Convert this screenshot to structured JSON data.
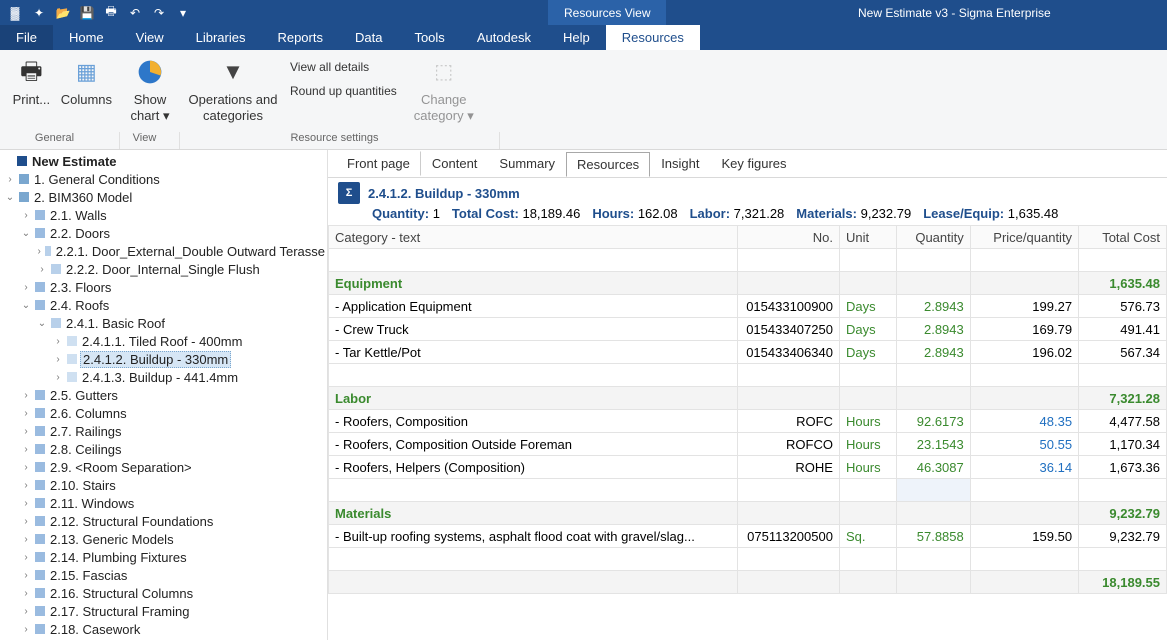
{
  "window": {
    "context_tab": "Resources View",
    "document": "New Estimate v3 - Sigma Enterprise"
  },
  "menus": {
    "file": "File",
    "home": "Home",
    "view": "View",
    "libraries": "Libraries",
    "reports": "Reports",
    "data": "Data",
    "tools": "Tools",
    "autodesk": "Autodesk",
    "help": "Help",
    "resources": "Resources"
  },
  "ribbon": {
    "print": "Print...",
    "columns": "Columns",
    "showchart": "Show chart",
    "ops": "Operations and categories",
    "viewall": "View all details",
    "roundup": "Round up quantities",
    "changecat": "Change category",
    "g1": "General",
    "g2": "View",
    "g3": "Resource settings"
  },
  "tree": {
    "root": "New Estimate",
    "n1": "1. General Conditions",
    "n2": "2. BIM360 Model",
    "n21": "2.1. Walls",
    "n22": "2.2. Doors",
    "n221": "2.2.1. Door_External_Double Outward Terasse",
    "n222": "2.2.2. Door_Internal_Single Flush",
    "n23": "2.3. Floors",
    "n24": "2.4. Roofs",
    "n241": "2.4.1. Basic Roof",
    "n2411": "2.4.1.1. Tiled Roof - 400mm",
    "n2412": "2.4.1.2. Buildup - 330mm",
    "n2413": "2.4.1.3. Buildup - 441.4mm",
    "n25": "2.5. Gutters",
    "n26": "2.6. Columns",
    "n27": "2.7. Railings",
    "n28": "2.8. Ceilings",
    "n29": "2.9. <Room Separation>",
    "n210": "2.10. Stairs",
    "n211": "2.11. Windows",
    "n212": "2.12. Structural Foundations",
    "n213": "2.13. Generic Models",
    "n214": "2.14. Plumbing Fixtures",
    "n215": "2.15. Fascias",
    "n216": "2.16. Structural Columns",
    "n217": "2.17. Structural Framing",
    "n218": "2.18. Casework"
  },
  "ctabs": {
    "front": "Front page",
    "content": "Content",
    "summary": "Summary",
    "resources": "Resources",
    "insight": "Insight",
    "keyfig": "Key figures"
  },
  "header": {
    "title": "2.4.1.2. Buildup - 330mm",
    "qtyL": "Quantity:",
    "qtyV": "1",
    "tcL": "Total Cost:",
    "tcV": "18,189.46",
    "hrL": "Hours:",
    "hrV": "162.08",
    "lbL": "Labor:",
    "lbV": "7,321.28",
    "mtL": "Materials:",
    "mtV": "9,232.79",
    "leL": "Lease/Equip:",
    "leV": "1,635.48"
  },
  "cols": {
    "cat": "Category - text",
    "no": "No.",
    "unit": "Unit",
    "qty": "Quantity",
    "pq": "Price/quantity",
    "tc": "Total Cost"
  },
  "rows": {
    "equip": "Equipment",
    "equipTot": "1,635.48",
    "r1n": " - Application Equipment",
    "r1no": "015433100900",
    "r1u": "Days",
    "r1q": "2.8943",
    "r1p": "199.27",
    "r1t": "576.73",
    "r2n": " - Crew Truck",
    "r2no": "015433407250",
    "r2u": "Days",
    "r2q": "2.8943",
    "r2p": "169.79",
    "r2t": "491.41",
    "r3n": " - Tar Kettle/Pot",
    "r3no": "015433406340",
    "r3u": "Days",
    "r3q": "2.8943",
    "r3p": "196.02",
    "r3t": "567.34",
    "labor": "Labor",
    "laborTot": "7,321.28",
    "r4n": " - Roofers, Composition",
    "r4no": "ROFC",
    "r4u": "Hours",
    "r4q": "92.6173",
    "r4p": "48.35",
    "r4t": "4,477.58",
    "r5n": " - Roofers, Composition Outside Foreman",
    "r5no": "ROFCO",
    "r5u": "Hours",
    "r5q": "23.1543",
    "r5p": "50.55",
    "r5t": "1,170.34",
    "r6n": " - Roofers, Helpers (Composition)",
    "r6no": "ROHE",
    "r6u": "Hours",
    "r6q": "46.3087",
    "r6p": "36.14",
    "r6t": "1,673.36",
    "mat": "Materials",
    "matTot": "9,232.79",
    "r7n": " - Built-up roofing systems, asphalt flood coat with gravel/slag...",
    "r7no": "075113200500",
    "r7u": "Sq.",
    "r7q": "57.8858",
    "r7p": "159.50",
    "r7t": "9,232.79",
    "grand": "18,189.55"
  }
}
